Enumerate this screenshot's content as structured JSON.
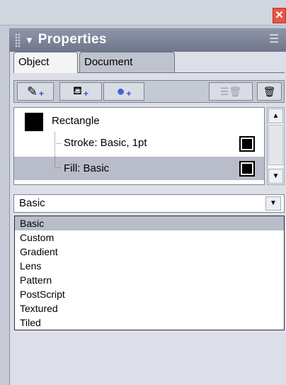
{
  "window": {
    "close_glyph": "✕"
  },
  "panel": {
    "title": "Properties",
    "collapse_glyph": "▼",
    "menu_glyph": "☰"
  },
  "tabs": [
    {
      "label": "Object",
      "active": true
    },
    {
      "label": "Document",
      "active": false
    }
  ],
  "toolbar": {
    "buttons": [
      {
        "icon": "pencil-icon",
        "glyph": "✎",
        "plus": "+"
      },
      {
        "icon": "paint-bucket-icon",
        "glyph": "⛾",
        "plus": "+"
      },
      {
        "icon": "sphere-icon",
        "glyph": "●",
        "plus": "+"
      },
      {
        "icon": "duplicate-delete-icon",
        "glyph": "☰🗑"
      },
      {
        "icon": "trash-icon",
        "glyph": "🗑"
      }
    ]
  },
  "attributes": {
    "object_name": "Rectangle",
    "stroke": "Stroke: Basic, 1pt",
    "fill": "Fill: Basic",
    "selected_row": "fill"
  },
  "scrollbar": {
    "up": "▲",
    "down": "▼"
  },
  "fill_type": {
    "value": "Basic",
    "arrow": "▼",
    "options": [
      "Basic",
      "Custom",
      "Gradient",
      "Lens",
      "Pattern",
      "PostScript",
      "Textured",
      "Tiled"
    ],
    "selected": "Basic"
  },
  "colors": {
    "header": "#7c8397",
    "selection": "#b9bdca",
    "close": "#e85642"
  }
}
